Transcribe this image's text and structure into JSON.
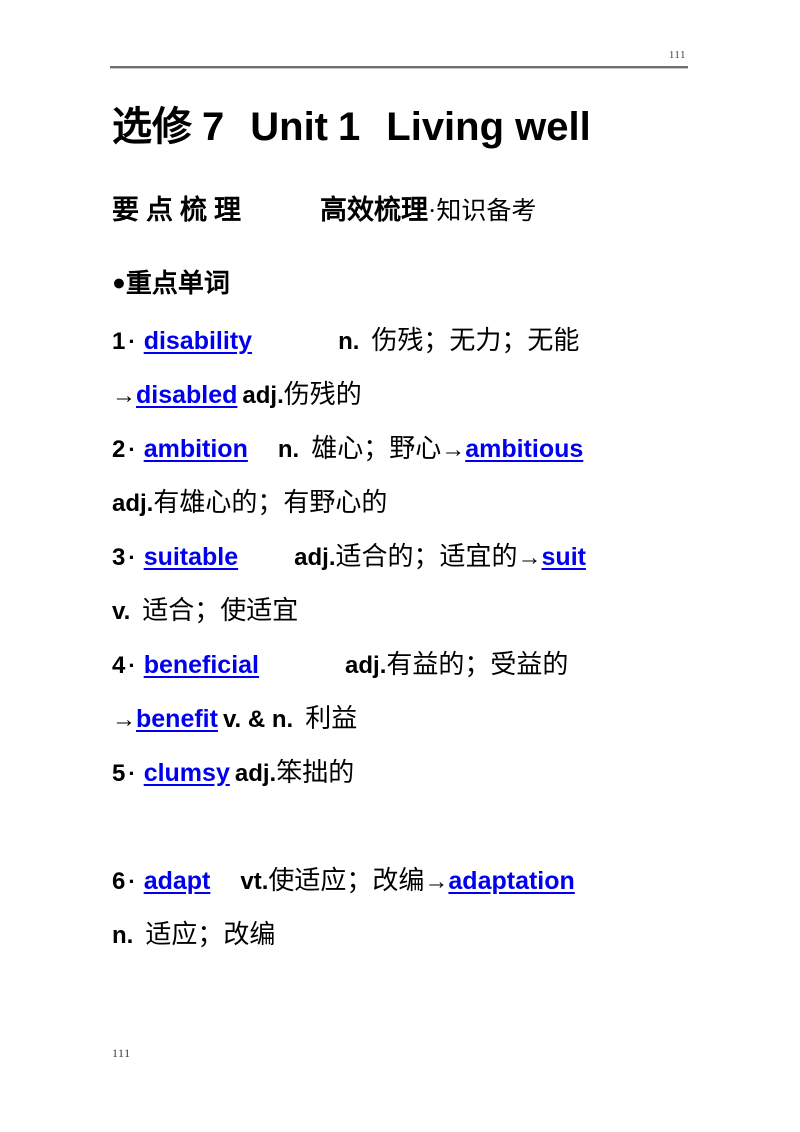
{
  "header": {
    "page_number": "111",
    "rule_color": "#6f6f6f"
  },
  "title": {
    "prefix": "选修",
    "book_number": "7",
    "unit": "Unit",
    "unit_number": "1",
    "unit_title": "Living well"
  },
  "section": {
    "label": "要点梳理",
    "tag_bold": "高效梳理",
    "tag_serif": "·知识备考"
  },
  "subsection": {
    "bullet": "●",
    "heading": "重点单词"
  },
  "accent_color": "#0000ee",
  "entries": [
    {
      "number": "1",
      "dot": "·",
      "word": "disability",
      "pos": "n.",
      "meaning": "伤残；无力；无能",
      "derived_arrow": "→",
      "derived_word": "disabled",
      "derived_pos": "adj.",
      "derived_meaning": "伤残的"
    },
    {
      "number": "2",
      "dot": "·",
      "word": "ambition",
      "pos": "n.",
      "meaning": "雄心；野心",
      "derived_arrow": "→",
      "derived_word": "ambitious",
      "derived_pos": "adj.",
      "derived_meaning": "有雄心的；有野心的"
    },
    {
      "number": "3",
      "dot": "·",
      "word": "suitable",
      "pos": "adj.",
      "meaning": "适合的；适宜的",
      "derived_arrow": "→",
      "derived_word": "suit",
      "derived_pos": "v.",
      "derived_meaning": "适合；使适宜"
    },
    {
      "number": "4",
      "dot": "·",
      "word": "beneficial",
      "pos": "adj.",
      "meaning": "有益的；受益的",
      "derived_arrow": "→",
      "derived_word": "benefit",
      "derived_pos": "v. & n.",
      "derived_meaning": "利益"
    },
    {
      "number": "5",
      "dot": "·",
      "word": "clumsy",
      "pos": "adj.",
      "meaning": "笨拙的",
      "derived_arrow": "",
      "derived_word": "",
      "derived_pos": "",
      "derived_meaning": ""
    },
    {
      "number": "6",
      "dot": "·",
      "word": "adapt",
      "pos": "vt.",
      "meaning": "使适应；改编",
      "derived_arrow": "→",
      "derived_word": "adaptation",
      "derived_pos": "n.",
      "derived_meaning": "适应；改编"
    }
  ],
  "footer": {
    "page_number": "111"
  }
}
